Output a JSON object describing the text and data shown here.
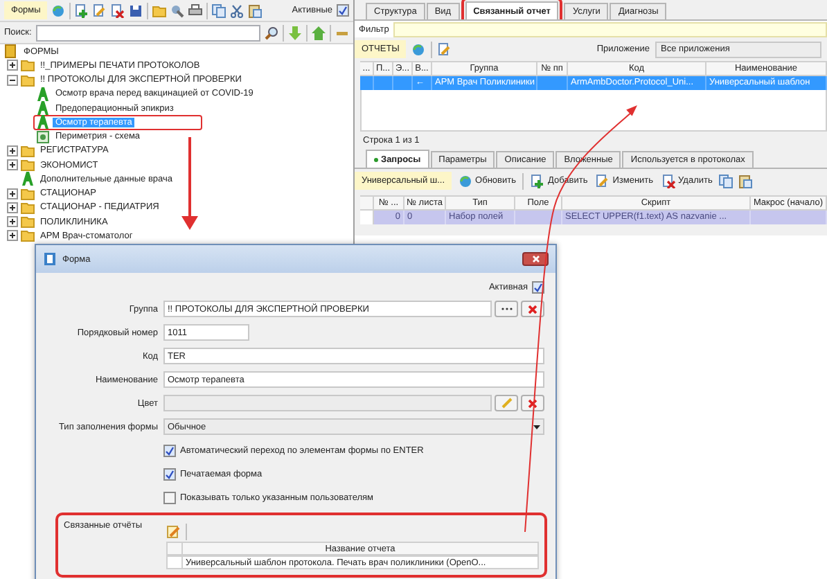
{
  "left": {
    "toolbar": {
      "label": "Формы",
      "active": {
        "label": "Активные",
        "checked": true
      }
    },
    "search": {
      "label": "Поиск:"
    },
    "tree": [
      {
        "label": "ФОРМЫ",
        "kind": "root",
        "selected": false,
        "annotated": false,
        "children": [
          {
            "label": "!!_ПРИМЕРЫ ПЕЧАТИ ПРОТОКОЛОВ",
            "kind": "folder",
            "expanded": false,
            "selected": false,
            "annotated": false
          },
          {
            "label": "!! ПРОТОКОЛЫ ДЛЯ ЭКСПЕРТНОЙ ПРОВЕРКИ",
            "kind": "folder",
            "expanded": true,
            "selected": false,
            "annotated": false,
            "children": [
              {
                "label": "Осмотр врача перед вакцинацией от COVID-19",
                "kind": "form",
                "selected": false,
                "annotated": false
              },
              {
                "label": "Предоперационный эпикриз",
                "kind": "form",
                "selected": false,
                "annotated": false
              },
              {
                "label": "Осмотр терапевта",
                "kind": "form",
                "selected": true,
                "annotated": true
              },
              {
                "label": "Периметрия - схема",
                "kind": "scheme",
                "selected": false,
                "annotated": false
              }
            ]
          },
          {
            "label": "РЕГИСТРАТУРА",
            "kind": "folder",
            "expanded": false,
            "selected": false,
            "annotated": false
          },
          {
            "label": "ЭКОНОМИСТ",
            "kind": "folder",
            "expanded": false,
            "selected": false,
            "annotated": false
          },
          {
            "label": "Дополнительные данные врача",
            "kind": "form",
            "selected": false,
            "annotated": false
          },
          {
            "label": "СТАЦИОНАР",
            "kind": "folder",
            "expanded": false,
            "selected": false,
            "annotated": false
          },
          {
            "label": "СТАЦИОНАР - ПЕДИАТРИЯ",
            "kind": "folder",
            "expanded": false,
            "selected": false,
            "annotated": false
          },
          {
            "label": "ПОЛИКЛИНИКА",
            "kind": "folder",
            "expanded": false,
            "selected": false,
            "annotated": false
          },
          {
            "label": "АРМ Врач-стоматолог",
            "kind": "folder",
            "expanded": false,
            "selected": false,
            "annotated": false
          }
        ]
      }
    ]
  },
  "right": {
    "tabs": [
      {
        "label": "Структура",
        "selected": false,
        "annotated": false
      },
      {
        "label": "Вид",
        "selected": false,
        "annotated": false
      },
      {
        "label": "Связанный отчет",
        "selected": true,
        "annotated": true
      },
      {
        "label": "Услуги",
        "selected": false,
        "annotated": false
      },
      {
        "label": "Диагнозы",
        "selected": false,
        "annotated": false
      }
    ],
    "filter_label": "Фильтр",
    "reports": {
      "label": "ОТЧЕТЫ",
      "app_label": "Приложение",
      "app_value": "Все приложения",
      "columns": [
        "...",
        "П...",
        "Э...",
        "В...",
        "Группа",
        "№ пп",
        "Код",
        "Наименование"
      ],
      "rows": [
        {
          "cells": [
            "",
            "",
            "",
            "←",
            "АРМ Врач Поликлиники",
            "",
            "ArmAmbDoctor.Protocol_Uni...",
            "Универсальный шаблон"
          ],
          "selected": true
        }
      ],
      "status": "Строка 1 из 1"
    },
    "lower_tabs": [
      {
        "label": "Запросы",
        "selected": true
      },
      {
        "label": "Параметры",
        "selected": false
      },
      {
        "label": "Описание",
        "selected": false
      },
      {
        "label": "Вложенные",
        "selected": false
      },
      {
        "label": "Используется в протоколах",
        "selected": false
      }
    ],
    "queries": {
      "label": "Универсальный ш...",
      "buttons": [
        "Обновить",
        "Добавить",
        "Изменить",
        "Удалить"
      ],
      "columns": [
        "№ ...",
        "№ листа",
        "Тип",
        "Поле",
        "Скрипт",
        "Макрос (начало)"
      ],
      "rows": [
        {
          "cells": [
            "0",
            "0",
            "Набор полей",
            "",
            "SELECT UPPER(f1.text) AS nazvanie    ...",
            ""
          ],
          "selected": true
        }
      ]
    }
  },
  "dialog": {
    "title": "Форма",
    "active": {
      "label": "Активная",
      "checked": true
    },
    "fields": [
      {
        "label": "Группа",
        "value": "!! ПРОТОКОЛЫ ДЛЯ ЭКСПЕРТНОЙ ПРОВЕРКИ",
        "kind": "picker"
      },
      {
        "label": "Порядковый номер",
        "value": "1011",
        "kind": "short"
      },
      {
        "label": "Код",
        "value": "TER",
        "kind": "text"
      },
      {
        "label": "Наименование",
        "value": "Осмотр терапевта",
        "kind": "text"
      },
      {
        "label": "Цвет",
        "kind": "color"
      },
      {
        "label": "Тип заполнения формы",
        "value": "Обычное",
        "kind": "select"
      }
    ],
    "checkboxes": [
      {
        "label": "Автоматический переход по элементам формы по ENTER",
        "checked": true
      },
      {
        "label": "Печатаемая форма",
        "checked": true
      },
      {
        "label": "Показывать только указанным пользователям",
        "checked": false
      }
    ],
    "linked": {
      "label": "Связанные отчёты",
      "annotated": true,
      "column": "Название отчета",
      "rows": [
        "Универсальный шаблон протокола. Печать врач поликлиники (OpenO..."
      ]
    }
  }
}
